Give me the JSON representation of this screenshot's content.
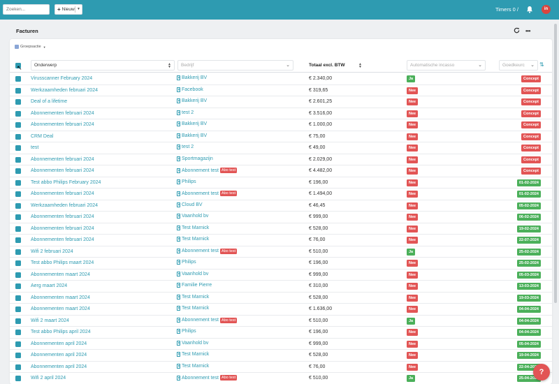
{
  "topbar": {
    "search_placeholder": "Zoeken...",
    "new_label": "Nieuw",
    "timers_label": "Timers 0 /",
    "avatar_initials": "in"
  },
  "page": {
    "title": "Facturen"
  },
  "toolbar": {
    "group_action_label": "Groepsactie"
  },
  "columns": {
    "subject": "Onderwerp",
    "company": "Bedrijf",
    "amount": "Totaal excl. BTW",
    "incasso": "Automatische incasso",
    "approved": "Goedkeurc"
  },
  "colors": {
    "brand": "#2e9bb1",
    "badge_red": "#e25555",
    "badge_green": "#4bb05a",
    "concept": "#e25555"
  },
  "rows": [
    {
      "subject": "Virusscanner February 2024",
      "company": "Bakkerij BV",
      "abo": "",
      "amount": "€ 2.340,00",
      "incasso": "Ja",
      "status": "Concept"
    },
    {
      "subject": "Werkzaamheden februari 2024",
      "company": "Facebook",
      "abo": "",
      "amount": "€ 319,65",
      "incasso": "Nee",
      "status": "Concept"
    },
    {
      "subject": "Deal of a lifetime",
      "company": "Bakkerij BV",
      "abo": "",
      "amount": "€ 2.601,25",
      "incasso": "Nee",
      "status": "Concept"
    },
    {
      "subject": "Abonnementen februari 2024",
      "company": "test 2",
      "abo": "",
      "amount": "€ 3.516,00",
      "incasso": "Nee",
      "status": "Concept"
    },
    {
      "subject": "Abonnementen februari 2024",
      "company": "Bakkerij BV",
      "abo": "",
      "amount": "€ 1.000,00",
      "incasso": "Nee",
      "status": "Concept"
    },
    {
      "subject": "CRM Deal",
      "company": "Bakkerij BV",
      "abo": "",
      "amount": "€ 75,00",
      "incasso": "Nee",
      "status": "Concept"
    },
    {
      "subject": "test",
      "company": "test 2",
      "abo": "",
      "amount": "€ 49,00",
      "incasso": "Nee",
      "status": "Concept"
    },
    {
      "subject": "Abonnementen februari 2024",
      "company": "Sportmagazijn",
      "abo": "",
      "amount": "€ 2.029,00",
      "incasso": "Nee",
      "status": "Concept"
    },
    {
      "subject": "Abonnementen februari 2024",
      "company": "Abonnement test",
      "abo": "Abo test",
      "amount": "€ 4.482,00",
      "incasso": "Nee",
      "status": "Concept"
    },
    {
      "subject": "Test abbo Philips February 2024",
      "company": "Philips",
      "abo": "",
      "amount": "€ 196,00",
      "incasso": "Nee",
      "status": "01-02-2024"
    },
    {
      "subject": "Abonnementen februari 2024",
      "company": "Abonnement test",
      "abo": "Abo test",
      "amount": "€ 1.494,00",
      "incasso": "Nee",
      "status": "01-02-2024"
    },
    {
      "subject": "Werkzaamheden februari 2024",
      "company": "Cloud BV",
      "abo": "",
      "amount": "€ 46,45",
      "incasso": "Nee",
      "status": "05-02-2024"
    },
    {
      "subject": "Abonnementen februari 2024",
      "company": "Vaanhold bv",
      "abo": "",
      "amount": "€ 999,00",
      "incasso": "Nee",
      "status": "06-02-2024"
    },
    {
      "subject": "Abonnementen februari 2024",
      "company": "Test Marnick",
      "abo": "",
      "amount": "€ 528,00",
      "incasso": "Nee",
      "status": "19-02-2024"
    },
    {
      "subject": "Abonnementen februari 2024",
      "company": "Test Marnick",
      "abo": "",
      "amount": "€ 76,00",
      "incasso": "Nee",
      "status": "22-07-2024"
    },
    {
      "subject": "Wifi 2 februari 2024",
      "company": "Abonnement test",
      "abo": "Abo test",
      "amount": "€ 510,00",
      "incasso": "Ja",
      "status": "25-02-2024"
    },
    {
      "subject": "Test abbo Philips maart 2024",
      "company": "Philips",
      "abo": "",
      "amount": "€ 196,00",
      "incasso": "Nee",
      "status": "25-02-2024"
    },
    {
      "subject": "Abonnementen maart 2024",
      "company": "Vaanhold bv",
      "abo": "",
      "amount": "€ 999,00",
      "incasso": "Nee",
      "status": "05-03-2024"
    },
    {
      "subject": "Aerg maart 2024",
      "company": "Familie Pierre",
      "abo": "",
      "amount": "€ 310,00",
      "incasso": "Nee",
      "status": "13-03-2024"
    },
    {
      "subject": "Abonnementen maart 2024",
      "company": "Test Marnick",
      "abo": "",
      "amount": "€ 528,00",
      "incasso": "Nee",
      "status": "19-03-2024"
    },
    {
      "subject": "Abonnementen maart 2024",
      "company": "Test Marnick",
      "abo": "",
      "amount": "€ 1.636,00",
      "incasso": "Nee",
      "status": "04-04-2024"
    },
    {
      "subject": "Wifi 2 maart 2024",
      "company": "Abonnement test",
      "abo": "Abo test",
      "amount": "€ 510,00",
      "incasso": "Ja",
      "status": "04-04-2024"
    },
    {
      "subject": "Test abbo Philips april 2024",
      "company": "Philips",
      "abo": "",
      "amount": "€ 196,00",
      "incasso": "Nee",
      "status": "04-04-2024"
    },
    {
      "subject": "Abonnementen april 2024",
      "company": "Vaanhold bv",
      "abo": "",
      "amount": "€ 999,00",
      "incasso": "Nee",
      "status": "05-04-2024"
    },
    {
      "subject": "Abonnementen april 2024",
      "company": "Test Marnick",
      "abo": "",
      "amount": "€ 528,00",
      "incasso": "Nee",
      "status": "19-04-2024"
    },
    {
      "subject": "Abonnementen april 2024",
      "company": "Test Marnick",
      "abo": "",
      "amount": "€ 76,00",
      "incasso": "Nee",
      "status": "22-04-2024"
    },
    {
      "subject": "Wifi 2 april 2024",
      "company": "Abonnement test",
      "abo": "Abo test",
      "amount": "€ 510,00",
      "incasso": "Ja",
      "status": "25-04-2024"
    }
  ],
  "help_label": "?"
}
